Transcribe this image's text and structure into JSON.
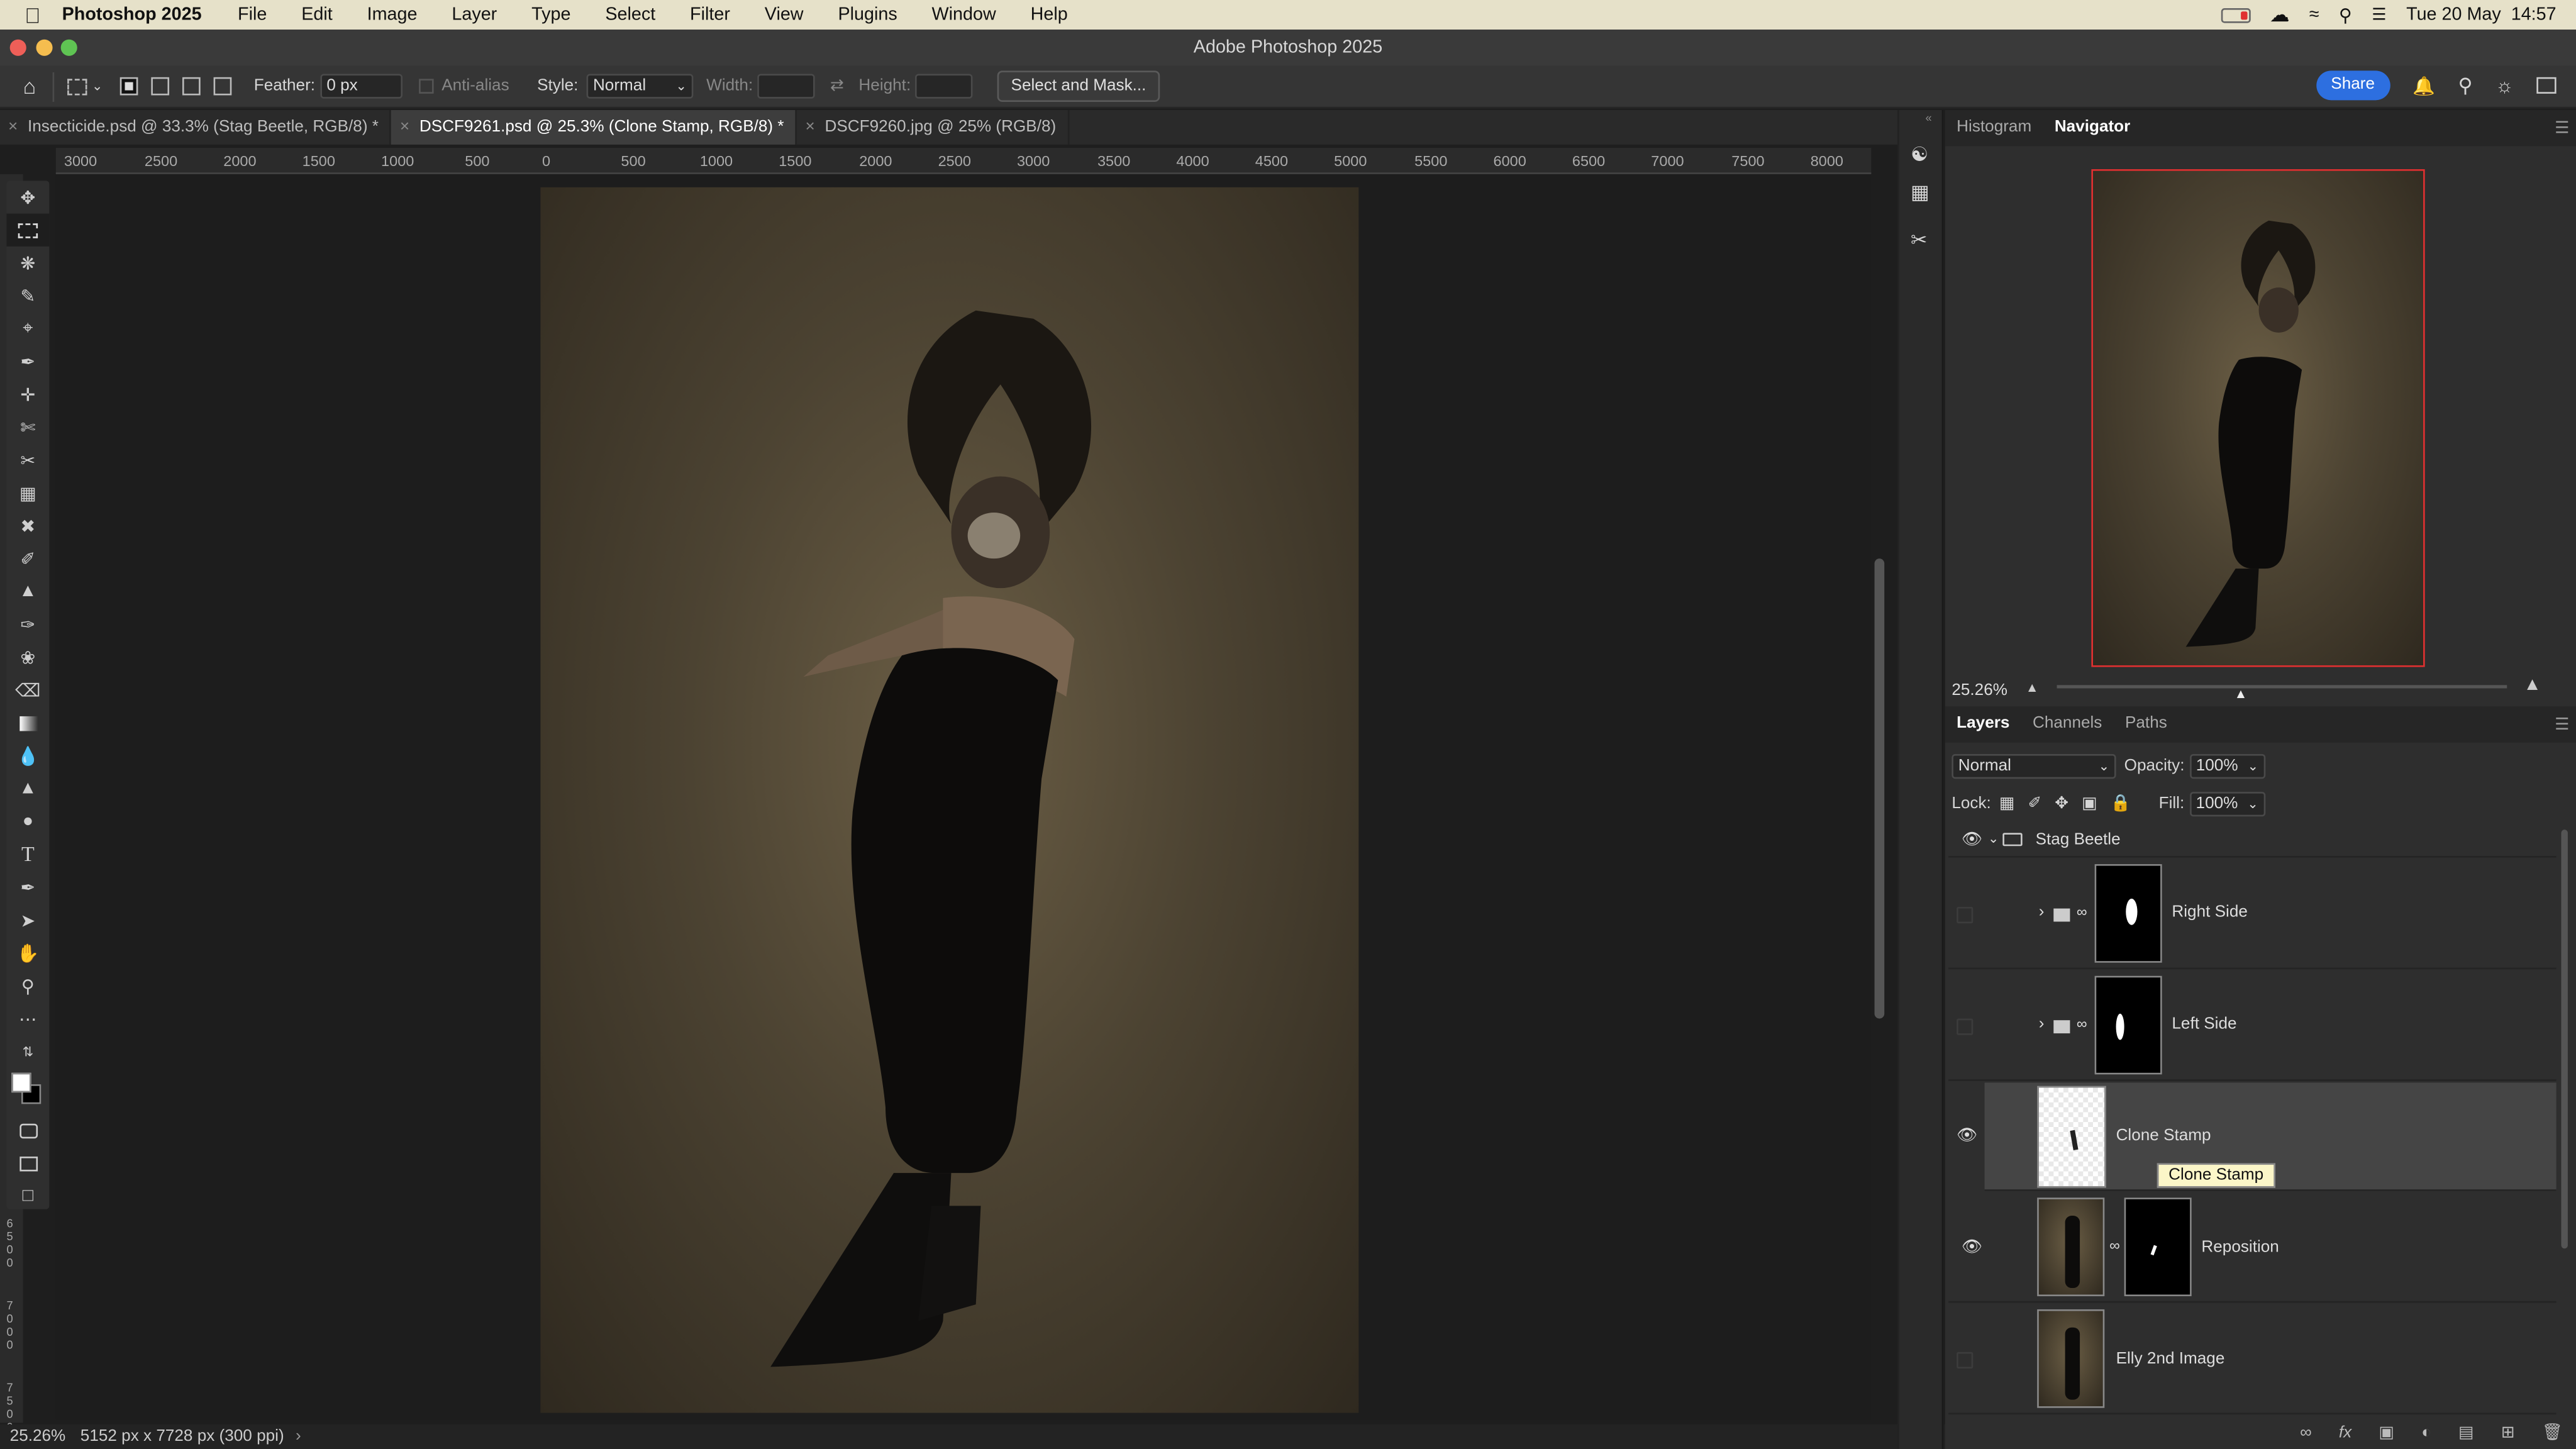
{
  "menubar": {
    "app": "Photoshop 2025",
    "items": [
      "File",
      "Edit",
      "Image",
      "Layer",
      "Type",
      "Select",
      "Filter",
      "View",
      "Plugins",
      "Window",
      "Help"
    ],
    "datetime": "Tue 20 May  14:57"
  },
  "window": {
    "title": "Adobe Photoshop 2025"
  },
  "options": {
    "feather_label": "Feather:",
    "feather_value": "0 px",
    "antialias_label": "Anti-alias",
    "style_label": "Style:",
    "style_value": "Normal",
    "width_label": "Width:",
    "height_label": "Height:",
    "select_mask": "Select and Mask...",
    "share": "Share"
  },
  "tabs": [
    {
      "label": "Insecticide.psd @ 33.3% (Stag Beetle, RGB/8) *"
    },
    {
      "label": "DSCF9261.psd @ 25.3% (Clone Stamp, RGB/8) *"
    },
    {
      "label": "DSCF9260.jpg @ 25% (RGB/8)"
    }
  ],
  "ruler": {
    "h_ticks": [
      "3000",
      "2500",
      "2000",
      "1500",
      "1000",
      "500",
      "0",
      "500",
      "1000",
      "1500",
      "2000",
      "2500",
      "3000",
      "3500",
      "4000",
      "4500",
      "5000",
      "5500",
      "6000",
      "6500",
      "7000",
      "7500",
      "8000"
    ],
    "v_ticks": [
      "6500",
      "7000",
      "7500"
    ]
  },
  "status": {
    "zoom": "25.26%",
    "doc": "5152 px x 7728 px (300 ppi)"
  },
  "panels": {
    "top_tabs": [
      "Histogram",
      "Navigator"
    ],
    "nav_zoom": "25.26%",
    "bottom_tabs": [
      "Layers",
      "Channels",
      "Paths"
    ],
    "blend_mode": "Normal",
    "opacity_label": "Opacity:",
    "opacity": "100%",
    "lock_label": "Lock:",
    "fill_label": "Fill:",
    "fill": "100%"
  },
  "layers": [
    {
      "name": "Stag Beetle"
    },
    {
      "name": "Right Side"
    },
    {
      "name": "Left Side"
    },
    {
      "name": "Clone Stamp",
      "tooltip": "Clone Stamp"
    },
    {
      "name": "Reposition"
    },
    {
      "name": "Elly 2nd Image"
    }
  ],
  "colors": {
    "accent": "#2d6fe0",
    "nav_frame": "#e03030"
  }
}
